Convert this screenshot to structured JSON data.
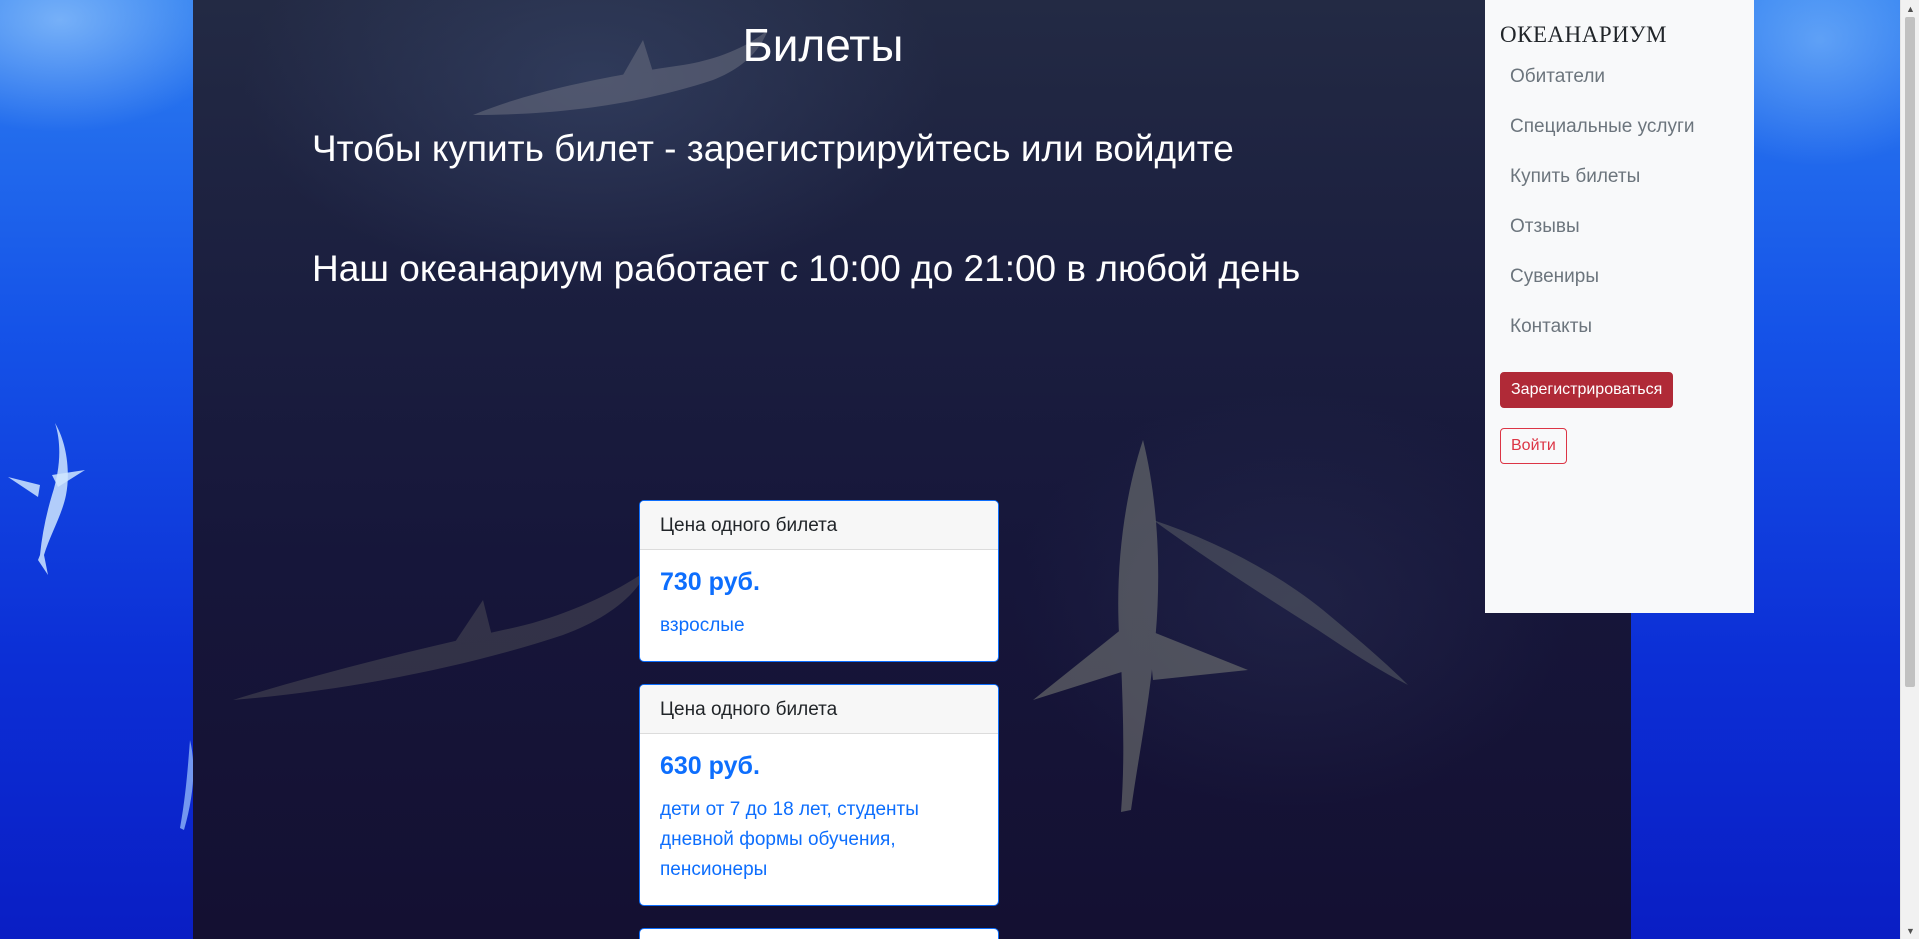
{
  "page": {
    "title": "Билеты",
    "login_prompt": "Чтобы купить билет - зарегистрируйтесь или войдите",
    "hours": "Наш океанариум работает с 10:00 до 21:00 в любой день"
  },
  "tickets": [
    {
      "header": "Цена одного билета",
      "price": "730 руб.",
      "category": "взрослые"
    },
    {
      "header": "Цена одного билета",
      "price": "630 руб.",
      "category": "дети от 7 до 18 лет, студенты дневной формы обучения, пенсионеры"
    }
  ],
  "sidebar": {
    "brand": "ОКЕАНАРИУМ",
    "items": [
      {
        "label": "Обитатели"
      },
      {
        "label": "Специальные услуги"
      },
      {
        "label": "Купить билеты"
      },
      {
        "label": "Отзывы"
      },
      {
        "label": "Сувениры"
      },
      {
        "label": "Контакты"
      }
    ],
    "register_label": "Зарегистрироваться",
    "login_label": "Войти"
  },
  "colors": {
    "accent": "#0d6efd",
    "register_button": "#b02a37",
    "login_outline": "#dc3545",
    "sidebar_bg": "#f8f9fa"
  }
}
